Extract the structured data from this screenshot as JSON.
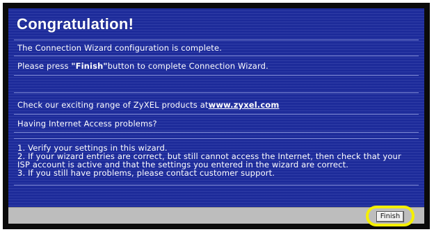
{
  "dialog": {
    "title": "Congratulation!",
    "complete_text": "The Connection Wizard configuration is complete.",
    "press_prefix": "Please press ",
    "press_button_name": "\"Finish\"",
    "press_suffix": "button to complete Connection Wizard.",
    "products_prefix": "Check our exciting range of ZyXEL products at",
    "products_link": "www.zyxel.com",
    "problems_heading": "Having Internet Access problems?",
    "steps": [
      "1. Verify your settings in this wizard.",
      "2. If your wizard entries are correct, but still cannot access the Internet, then check that your",
      "ISP account is active and that the settings you entered in the wizard are correct.",
      "3. If you still have problems, please contact customer support."
    ]
  },
  "footer": {
    "finish_label": "Finish",
    "highlight_color": "#f4ef00"
  },
  "colors": {
    "panel_background": "#1d2b9a",
    "footer_background": "#bdbdbd"
  }
}
